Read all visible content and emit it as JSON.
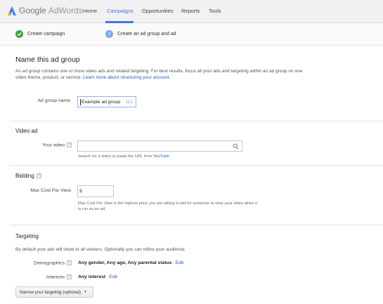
{
  "header": {
    "logo_google": "Google",
    "logo_adwords": "AdWords",
    "nav": [
      {
        "label": "Home"
      },
      {
        "label": "Campaigns"
      },
      {
        "label": "Opportunities"
      },
      {
        "label": "Reports"
      },
      {
        "label": "Tools"
      }
    ],
    "active_nav": "Campaigns",
    "accent_color": "#3b78e7"
  },
  "steps": [
    {
      "label": "Create campaign",
      "state": "done",
      "icon": "check-icon"
    },
    {
      "label": "Create an ad group and ad",
      "state": "current",
      "number": "2"
    }
  ],
  "adgroup": {
    "title": "Name this ad group",
    "description": "An ad group contains one or more video ads and related targeting. For best results, focus all your ads and targeting within an ad group on one video theme, product, or service.",
    "learn_more_link": "Learn more about structuring your account.",
    "name_label": "Ad group name",
    "name_value": "Example ad group",
    "chars_remaining": "112"
  },
  "video_ad": {
    "heading": "Video ad",
    "your_video_label": "Your video",
    "search_value": "",
    "hint_prefix": "Search for a video or paste the URL from",
    "hint_link": "YouTube."
  },
  "bidding": {
    "heading": "Bidding",
    "max_cpv_label": "Max Cost Per View",
    "currency": "$",
    "max_cpv_value": "",
    "hint": "Max Cost Per View is the highest price you are willing to bid for someone to view your video when it is run as an ad."
  },
  "targeting": {
    "heading": "Targeting",
    "description": "By default your ads will show to all viewers. Optionally you can refine your audience.",
    "demographics_label": "Demographics",
    "demographics_value": "Any gender, Any age, Any parental status",
    "interests_label": "Interests",
    "interests_value": "Any interest",
    "edit_label": "Edit",
    "narrow_button": "Narrow your targeting (optional)"
  },
  "help_glyph": "?"
}
